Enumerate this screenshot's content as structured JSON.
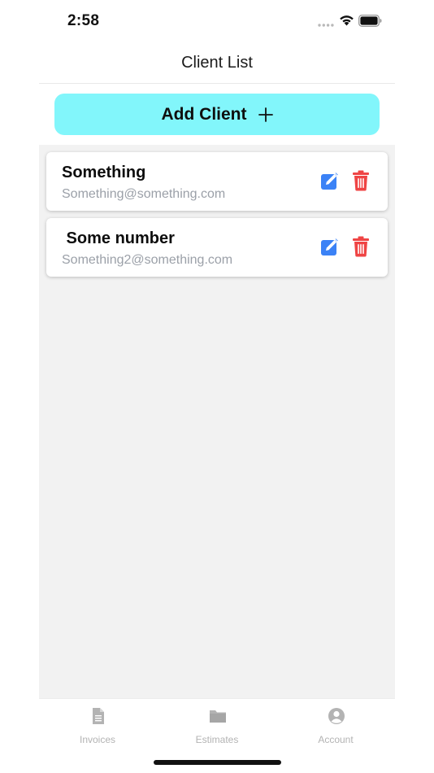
{
  "status_bar": {
    "time": "2:58"
  },
  "header": {
    "title": "Client List"
  },
  "add_client": {
    "label": "Add Client"
  },
  "clients": [
    {
      "name": "Something",
      "email": "Something@something.com"
    },
    {
      "name": " Some number",
      "email": "Something2@something.com"
    }
  ],
  "tabs": [
    {
      "label": "Invoices",
      "icon": "document-icon"
    },
    {
      "label": "Estimates",
      "icon": "folder-icon"
    },
    {
      "label": "Account",
      "icon": "user-circle-icon"
    }
  ],
  "colors": {
    "accent_button": "#82f6fb",
    "edit_icon": "#3b82f6",
    "delete_icon": "#ef4444",
    "email_text": "#9ba0a8",
    "list_background": "#f2f2f2",
    "tab_inactive": "#b3b3b3"
  }
}
